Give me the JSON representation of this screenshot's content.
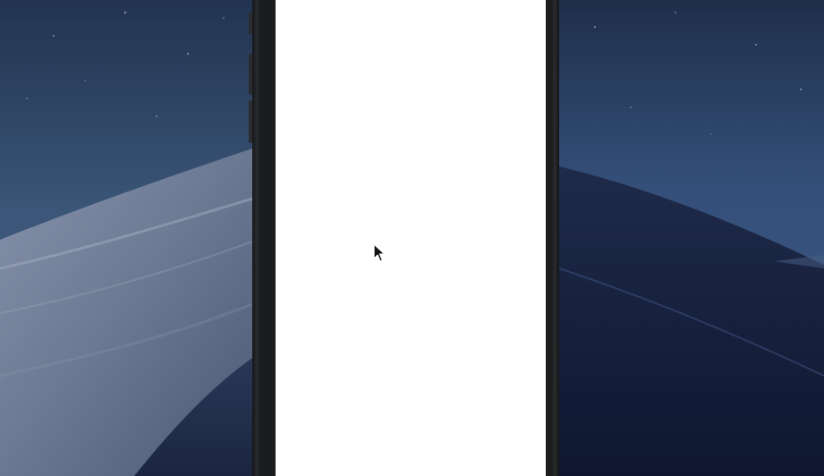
{
  "screen": {
    "background": "#ffffff",
    "state": "blank"
  },
  "wallpaper": {
    "theme": "night-desert-dunes",
    "sky_color": "#2c4365",
    "dune_color": "#6b7a96"
  },
  "device": {
    "frame_color": "#1b1c1e"
  },
  "cursor": {
    "icon": "arrow-pointer"
  }
}
